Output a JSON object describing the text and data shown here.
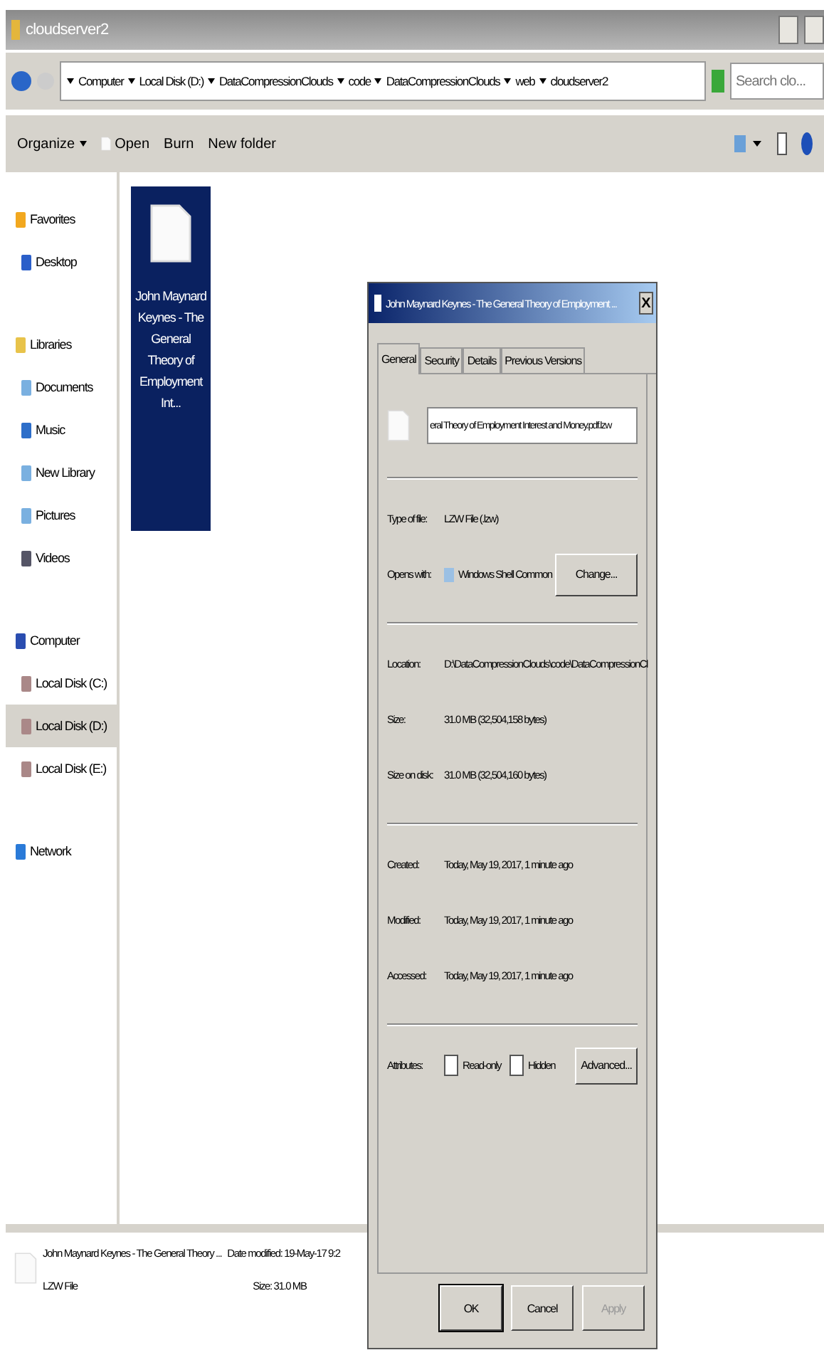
{
  "window": {
    "title": "cloudserver2"
  },
  "address": {
    "crumbs": [
      "Computer",
      "Local Disk (D:)",
      "DataCompressionClouds",
      "code",
      "DataCompressionClouds",
      "web",
      "cloudserver2"
    ],
    "search_placeholder": "Search clo..."
  },
  "toolbar": {
    "items": [
      {
        "label": "Organize",
        "kind": "menu"
      },
      {
        "label": "Open",
        "kind": "open"
      },
      {
        "label": "Burn",
        "kind": "plain"
      },
      {
        "label": "New folder",
        "kind": "plain"
      }
    ]
  },
  "sidebar": {
    "groups": [
      {
        "label": "Favorites",
        "children": [
          {
            "label": "Desktop",
            "selected": false
          }
        ]
      },
      {
        "label": "Libraries",
        "children": [
          {
            "label": "Documents",
            "selected": false
          },
          {
            "label": "Music",
            "selected": false
          },
          {
            "label": "New Library",
            "selected": false
          },
          {
            "label": "Pictures",
            "selected": false
          },
          {
            "label": "Videos",
            "selected": false
          }
        ]
      },
      {
        "label": "Computer",
        "children": [
          {
            "label": "Local Disk (C:)",
            "selected": false
          },
          {
            "label": "Local Disk (D:)",
            "selected": true
          },
          {
            "label": "Local Disk (E:)",
            "selected": false
          }
        ]
      },
      {
        "label": "Network"
      }
    ]
  },
  "files": [
    {
      "name": "John Maynard Keynes - The General Theory of Employment Int...",
      "selected": true
    }
  ],
  "details": {
    "name": "John Maynard Keynes - The General Theory ...",
    "type": "LZW File",
    "modified_label": "Date modified:",
    "modified_value": "19-May-17 9:2",
    "size_label": "Size:",
    "size_value": "31.0 MB"
  },
  "dialog": {
    "title": "John Maynard Keynes - The General Theory of Employment ...",
    "close": "X",
    "tabs": [
      {
        "label": "General",
        "selected": true
      },
      {
        "label": "Security",
        "selected": false
      },
      {
        "label": "Details",
        "selected": false
      },
      {
        "label": "Previous Versions",
        "selected": false
      }
    ],
    "filename": "eral Theory of Employment Interest and Money.pdf.lzw",
    "sections": [
      [
        {
          "label": "Type of file:",
          "value": "LZW File (.lzw)",
          "kind": "text"
        },
        {
          "label": "Opens with:",
          "value": "Windows Shell Common",
          "button": "Change...",
          "kind": "app"
        }
      ],
      [
        {
          "label": "Location:",
          "value": "D:\\DataCompressionClouds\\code\\DataCompressionCl",
          "kind": "text"
        },
        {
          "label": "Size:",
          "value": "31.0 MB (32,504,158 bytes)",
          "kind": "text"
        },
        {
          "label": "Size on disk:",
          "value": "31.0 MB (32,504,160 bytes)",
          "kind": "text"
        }
      ],
      [
        {
          "label": "Created:",
          "value": "Today, May 19, 2017, 1 minute ago",
          "kind": "text"
        },
        {
          "label": "Modified:",
          "value": "Today, May 19, 2017, 1 minute ago",
          "kind": "text"
        },
        {
          "label": "Accessed:",
          "value": "Today, May 19, 2017, 1 minute ago",
          "kind": "text"
        }
      ]
    ],
    "attributes": {
      "label": "Attributes:",
      "options": [
        {
          "label": "Read-only",
          "checked": false
        },
        {
          "label": "Hidden",
          "checked": false
        }
      ],
      "button": "Advanced..."
    },
    "buttons": [
      {
        "label": "OK",
        "disabled": false,
        "default": true
      },
      {
        "label": "Cancel",
        "disabled": false,
        "default": false
      },
      {
        "label": "Apply",
        "disabled": true,
        "default": false
      }
    ]
  }
}
